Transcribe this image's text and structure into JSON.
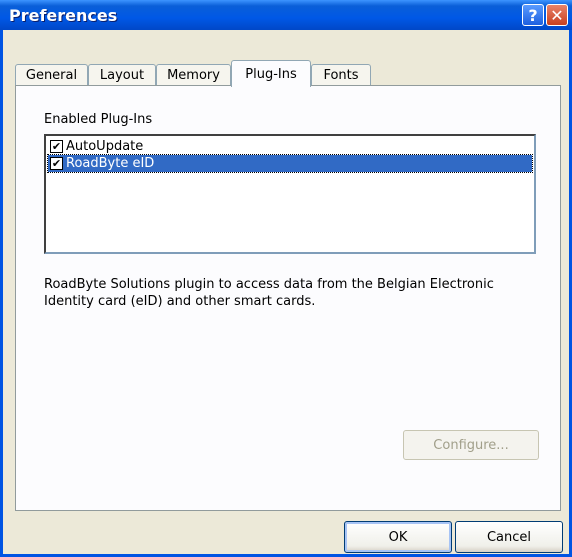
{
  "window": {
    "title": "Preferences"
  },
  "titlebar": {
    "help_label": "?",
    "close_label": "✕"
  },
  "tabs": [
    {
      "label": "General"
    },
    {
      "label": "Layout"
    },
    {
      "label": "Memory"
    },
    {
      "label": "Plug-Ins"
    },
    {
      "label": "Fonts"
    }
  ],
  "active_tab": "Plug-Ins",
  "plugins": {
    "group_label": "Enabled Plug-Ins",
    "items": [
      {
        "label": "AutoUpdate",
        "checked": true,
        "selected": false
      },
      {
        "label": "RoadByte eID",
        "checked": true,
        "selected": true
      }
    ],
    "description": "RoadByte Solutions plugin to access data from the Belgian Electronic Identity card (eID) and other smart cards.",
    "configure_label": "Configure..."
  },
  "buttons": {
    "ok_label": "OK",
    "cancel_label": "Cancel"
  },
  "colors": {
    "titlebar": "#0058e6",
    "selection": "#316ac5",
    "window_bg": "#ece9d8"
  }
}
